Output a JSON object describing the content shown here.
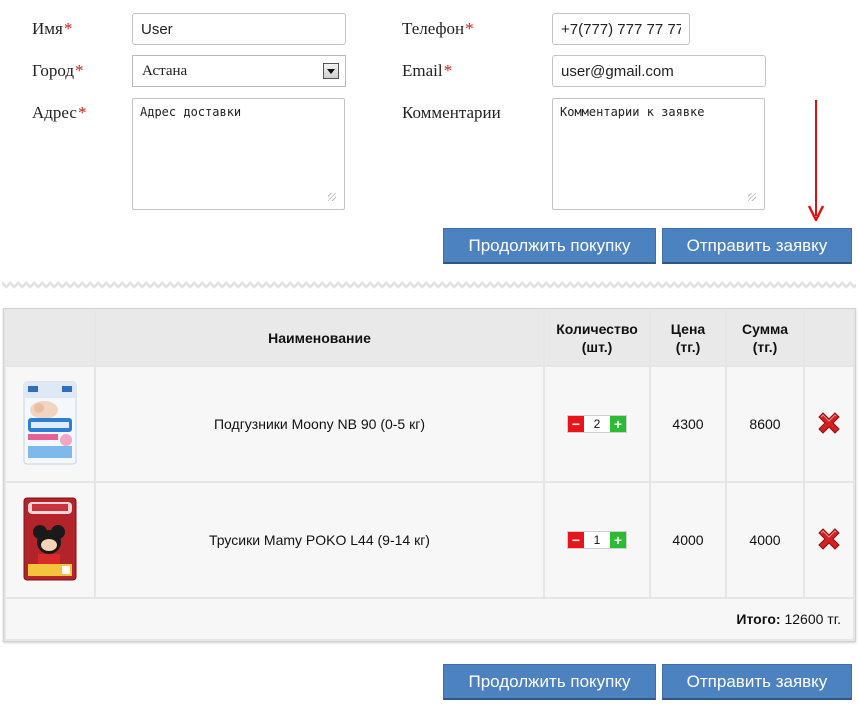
{
  "form": {
    "name": {
      "label": "Имя",
      "required": "*",
      "value": "User"
    },
    "city": {
      "label": "Город",
      "required": "*",
      "value": "Астана"
    },
    "address": {
      "label": "Адрес",
      "required": "*",
      "placeholder": "Адрес доставки"
    },
    "phone": {
      "label": "Телефон",
      "required": "*",
      "value": "+7(777) 777 77 77"
    },
    "email": {
      "label": "Email",
      "required": "*",
      "value": "user@gmail.com"
    },
    "comment": {
      "label": "Комментарии",
      "placeholder": "Комментарии к заявке"
    }
  },
  "buttons": {
    "continue": "Продолжить покупку",
    "submit": "Отправить заявку"
  },
  "cart": {
    "headers": {
      "name": "Наименование",
      "qty_line1": "Количество",
      "qty_line2": "(шт.)",
      "price_line1": "Цена",
      "price_line2": "(тг.)",
      "sum_line1": "Сумма",
      "sum_line2": "(тг.)"
    },
    "items": [
      {
        "name": "Подгузники Moony NB 90 (0-5 кг)",
        "qty": "2",
        "price": "4300",
        "sum": "8600",
        "image": "moony-diapers-package"
      },
      {
        "name": "Трусики Mamy POKO L44 (9-14 кг)",
        "qty": "1",
        "price": "4000",
        "sum": "4000",
        "image": "mamypoko-pants-package"
      }
    ],
    "total_label": "Итого:",
    "total_value": "12600 тг."
  },
  "icons": {
    "minus": "minus-icon",
    "plus": "plus-icon",
    "delete": "delete-x-icon",
    "annotation": "red-arrow-down"
  },
  "colors": {
    "required": "#d01818",
    "button": "#4d82c0",
    "minus": "#e8141a",
    "plus": "#2dbb33",
    "delete": "#d42020",
    "annotation_arrow": "#e01010"
  }
}
